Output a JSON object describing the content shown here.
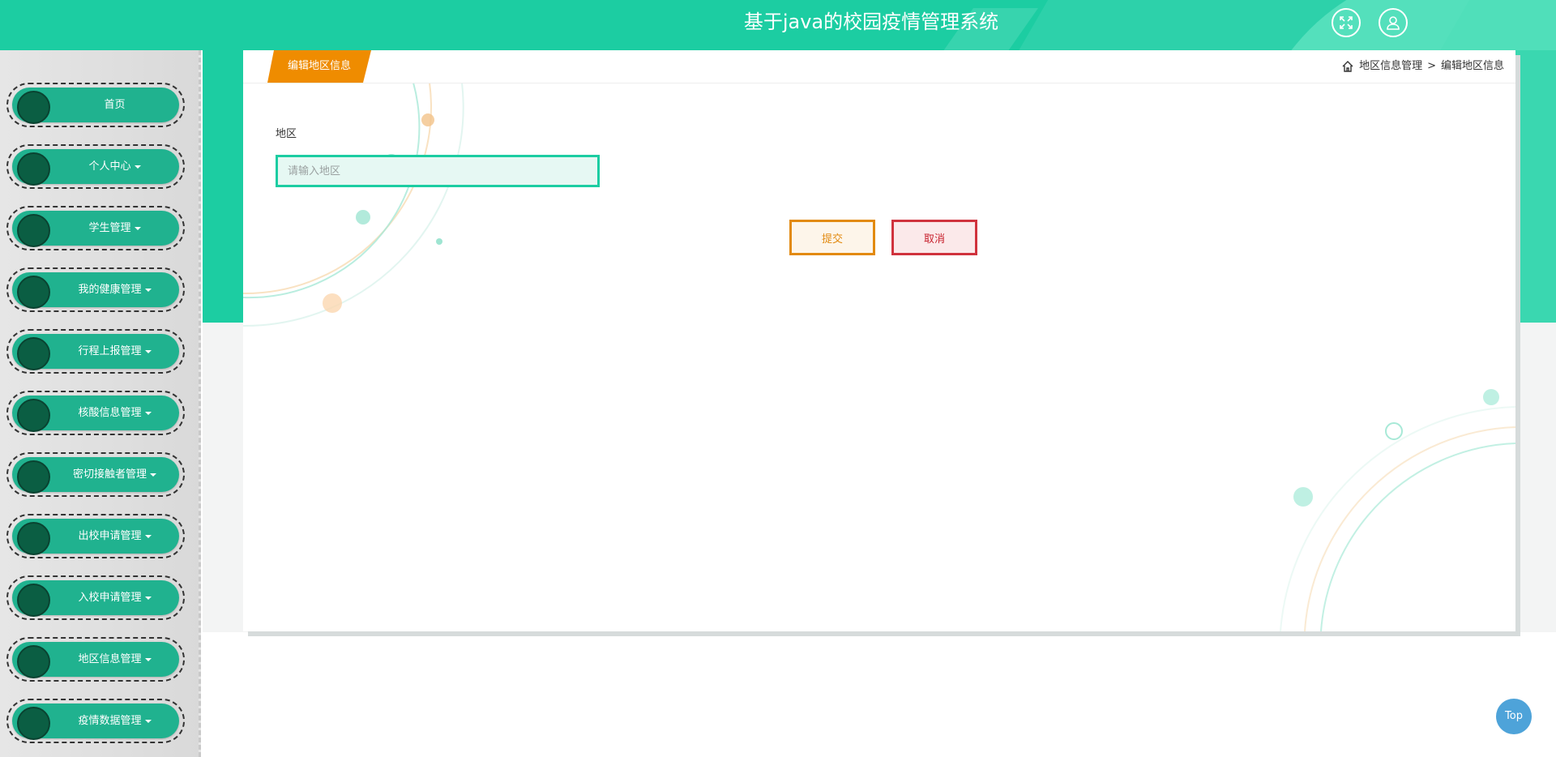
{
  "header": {
    "title": "基于java的校园疫情管理系统",
    "icons": [
      "fullscreen-icon",
      "user-icon"
    ]
  },
  "sidebar": {
    "items": [
      {
        "label": "首页",
        "has_caret": false
      },
      {
        "label": "个人中心",
        "has_caret": true
      },
      {
        "label": "学生管理",
        "has_caret": true
      },
      {
        "label": "我的健康管理",
        "has_caret": true
      },
      {
        "label": "行程上报管理",
        "has_caret": true
      },
      {
        "label": "核酸信息管理",
        "has_caret": true
      },
      {
        "label": "密切接触者管理",
        "has_caret": true
      },
      {
        "label": "出校申请管理",
        "has_caret": true
      },
      {
        "label": "入校申请管理",
        "has_caret": true
      },
      {
        "label": "地区信息管理",
        "has_caret": true
      },
      {
        "label": "疫情数据管理",
        "has_caret": true
      }
    ]
  },
  "card": {
    "tab_label": "编辑地区信息",
    "breadcrumb": {
      "home_icon": "home-icon",
      "parent": "地区信息管理",
      "separator": ">",
      "current": "编辑地区信息"
    },
    "form": {
      "region_label": "地区",
      "region_value": "",
      "region_placeholder": "请输入地区",
      "submit_label": "提交",
      "cancel_label": "取消"
    }
  },
  "back_to_top": "Top",
  "colors": {
    "primary": "#1ccda2",
    "sidebar_pill": "#20b28f",
    "tab": "#ef8c00",
    "submit": "#e28a10",
    "cancel": "#d0323d",
    "top_button": "#4ea3d9"
  }
}
